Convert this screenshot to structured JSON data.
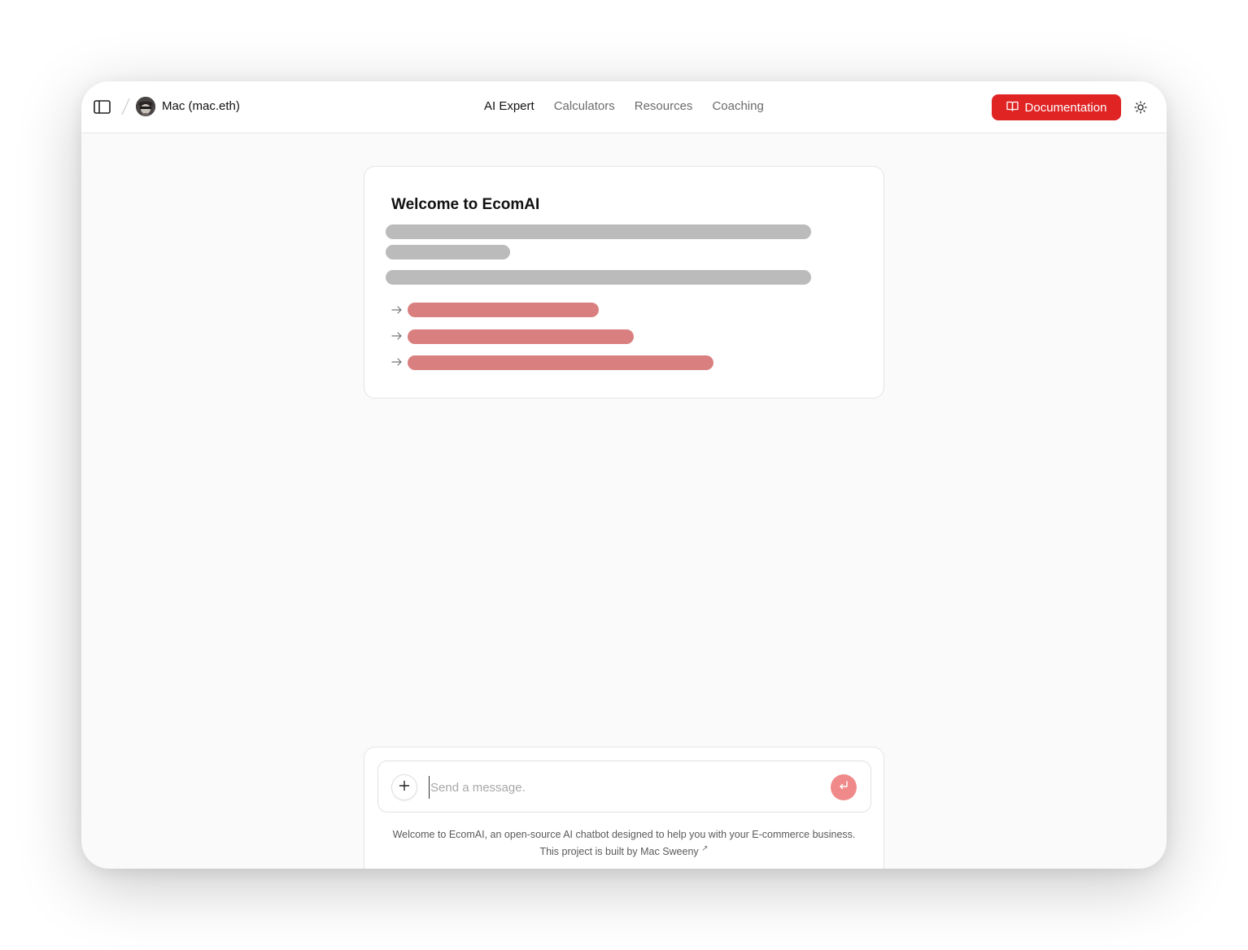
{
  "header": {
    "user_name": "Mac (mac.eth)",
    "nav": [
      {
        "label": "AI Expert",
        "active": true
      },
      {
        "label": "Calculators",
        "active": false
      },
      {
        "label": "Resources",
        "active": false
      },
      {
        "label": "Coaching",
        "active": false
      }
    ],
    "documentation_label": "Documentation",
    "accent_color": "#e02424"
  },
  "welcome_card": {
    "title": "Welcome to EcomAI"
  },
  "composer": {
    "placeholder": "Send a message.",
    "value": "",
    "footer_line1": "Welcome to EcomAI, an open-source AI chatbot designed to help you with your E-commerce business.",
    "footer_line2_prefix": "This project is built by ",
    "footer_link": "Mac Sweeny",
    "footer_link_icon": "↗"
  },
  "icons": {
    "sidebar_toggle": "sidebar-toggle-icon",
    "documentation": "book-open-icon",
    "theme": "sun-icon",
    "add": "plus-icon",
    "send": "enter-icon",
    "list_arrow": "arrow-right-icon"
  }
}
